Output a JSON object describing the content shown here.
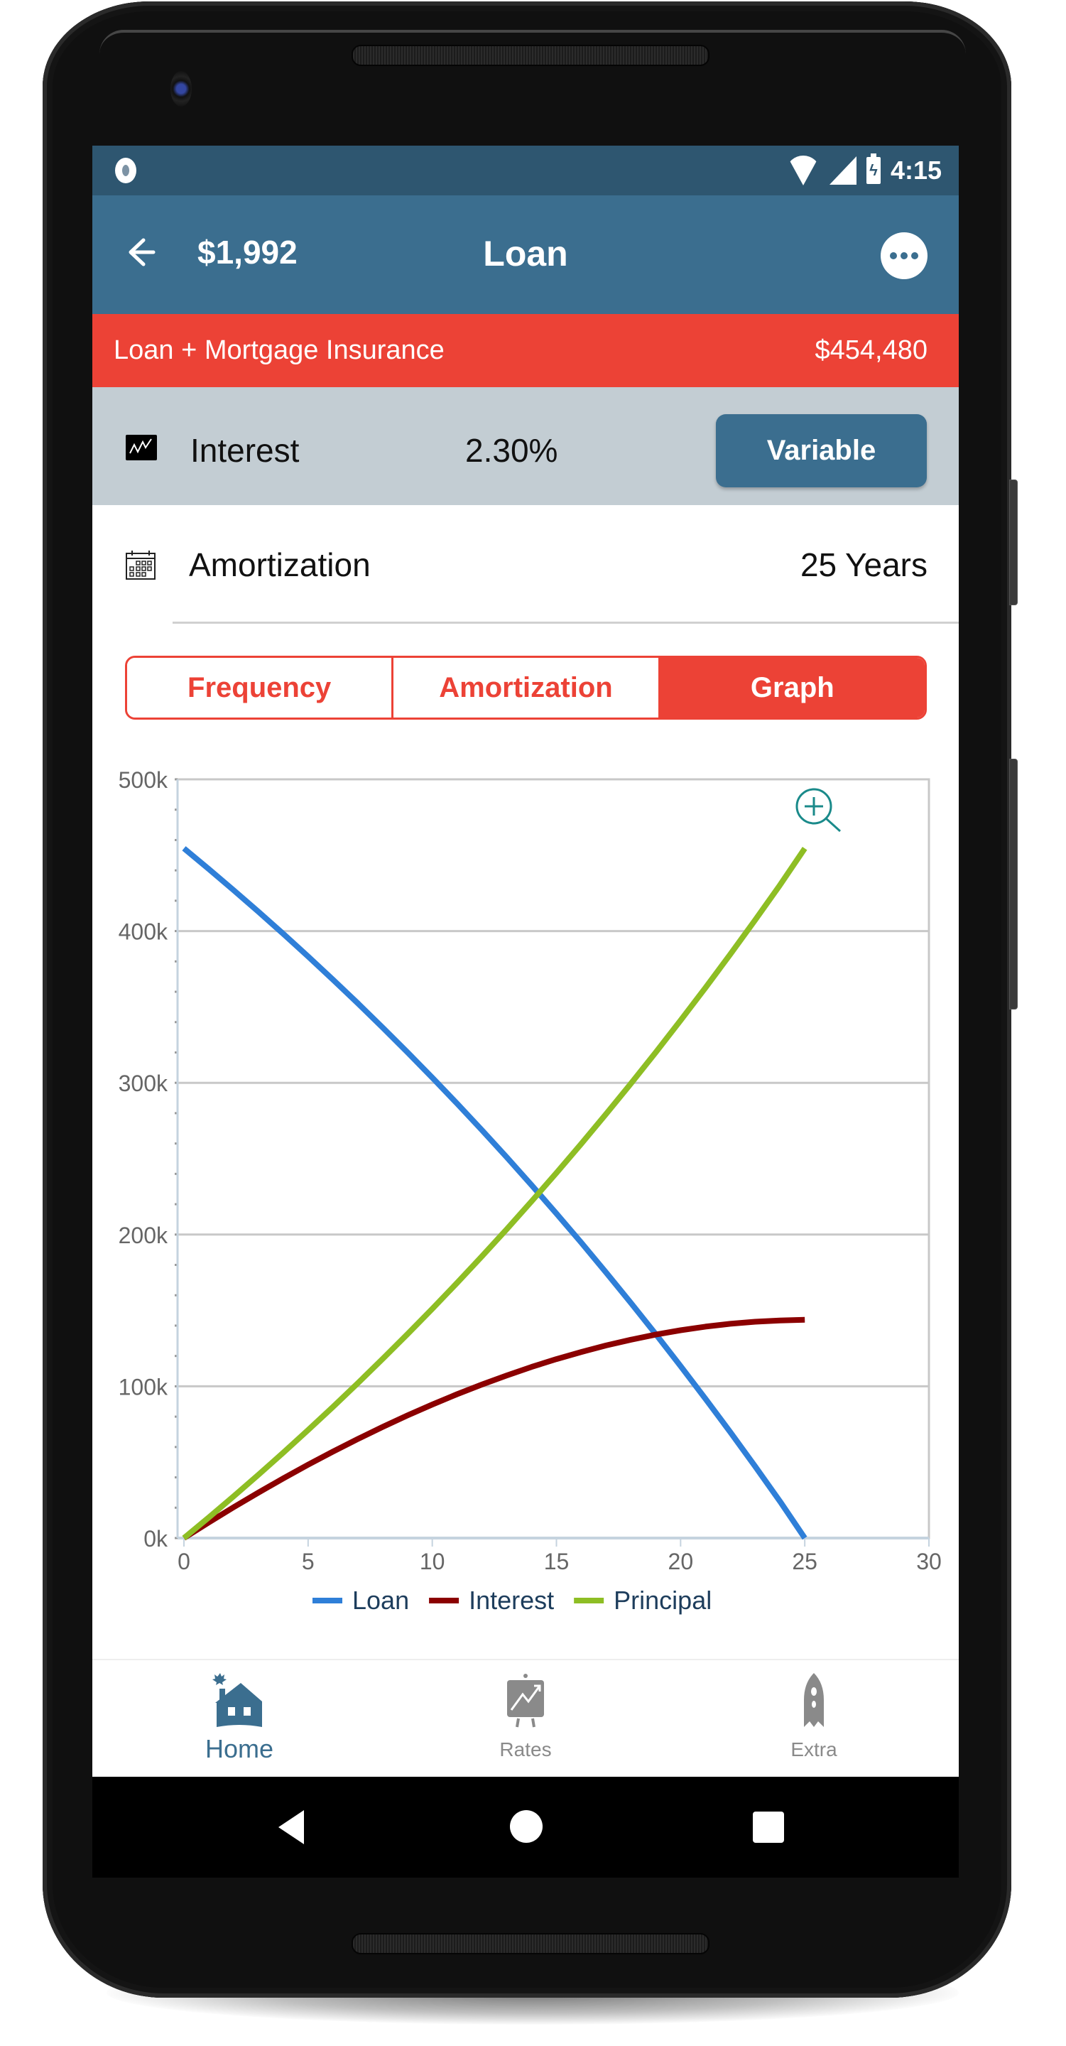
{
  "status_bar": {
    "time": "4:15",
    "icons": [
      "notification-circle-icon",
      "wifi-icon",
      "signal-icon",
      "battery-charging-icon"
    ]
  },
  "app_bar": {
    "payment": "$1,992",
    "title": "Loan",
    "back_icon": "arrow-left-icon",
    "more_icon": "more-horizontal-icon"
  },
  "insurance_bar": {
    "label": "Loan + Mortgage Insurance",
    "value": "$454,480"
  },
  "interest_row": {
    "icon": "line-chart-icon",
    "label": "Interest",
    "value": "2.30%",
    "type_button": "Variable"
  },
  "amortization_row": {
    "icon": "calendar-icon",
    "label": "Amortization",
    "value": "25 Years"
  },
  "tabs": [
    {
      "label": "Frequency",
      "active": false
    },
    {
      "label": "Amortization",
      "active": false
    },
    {
      "label": "Graph",
      "active": true
    }
  ],
  "colors": {
    "primary": "#3b6e8f",
    "status_bar": "#2e5670",
    "accent_red": "#ec4236",
    "interest_row_bg": "#c3cdd3",
    "zoom_icon": "#1a8a8a"
  },
  "chart_data": {
    "type": "line",
    "title": "",
    "xlabel": "",
    "ylabel": "",
    "x": [
      0,
      1,
      2,
      3,
      4,
      5,
      6,
      7,
      8,
      9,
      10,
      11,
      12,
      13,
      14,
      15,
      16,
      17,
      18,
      19,
      20,
      21,
      22,
      23,
      24,
      25
    ],
    "xlim": [
      0,
      30
    ],
    "ylim": [
      0,
      500000
    ],
    "x_ticks": [
      "0",
      "5",
      "10",
      "15",
      "20",
      "25",
      "30"
    ],
    "x_tick_values": [
      0,
      5,
      10,
      15,
      20,
      25,
      30
    ],
    "y_ticks": [
      "0k",
      "100k",
      "200k",
      "300k",
      "400k",
      "500k"
    ],
    "y_tick_values": [
      0,
      100000,
      200000,
      300000,
      400000,
      500000
    ],
    "grid": true,
    "legend_position": "bottom",
    "series": [
      {
        "name": "Loan",
        "color": "#2f7fd8",
        "values": [
          454480,
          440888,
          426980,
          412748,
          398186,
          383285,
          368038,
          352436,
          336472,
          320137,
          303422,
          286318,
          268817,
          250909,
          232585,
          213835,
          194649,
          175017,
          154929,
          134374,
          113341,
          91819,
          69797,
          47263,
          24206,
          0
        ]
      },
      {
        "name": "Interest",
        "color": "#8b0000",
        "values": [
          0,
          10312,
          20308,
          29980,
          39322,
          48325,
          56982,
          65284,
          73224,
          80793,
          87982,
          94782,
          101185,
          107181,
          112761,
          117915,
          122633,
          126905,
          130721,
          134070,
          136941,
          139323,
          141205,
          142575,
          143400,
          143800
        ]
      },
      {
        "name": "Principal",
        "color": "#8ebe24",
        "values": [
          0,
          13592,
          27500,
          41732,
          56294,
          71195,
          86442,
          102044,
          118008,
          134343,
          151058,
          168162,
          185663,
          203571,
          221895,
          240645,
          259831,
          279463,
          299551,
          320106,
          341139,
          362661,
          384683,
          407217,
          430274,
          454480
        ]
      }
    ],
    "zoom_icon": "zoom-in-icon"
  },
  "bottom_nav": [
    {
      "label": "Home",
      "icon": "home-icon",
      "active": true
    },
    {
      "label": "Rates",
      "icon": "rates-chart-icon",
      "active": false
    },
    {
      "label": "Extra",
      "icon": "rocket-icon",
      "active": false
    }
  ],
  "system_nav": [
    "back-triangle-icon",
    "home-circle-icon",
    "recents-square-icon"
  ]
}
